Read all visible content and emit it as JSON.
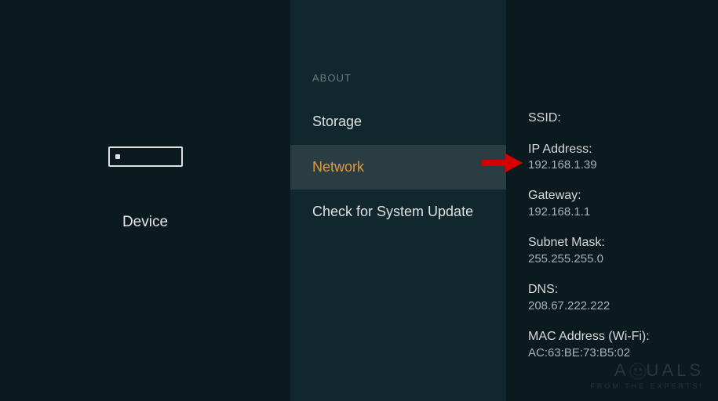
{
  "left": {
    "label": "Device"
  },
  "middle": {
    "header": "ABOUT",
    "items": [
      {
        "label": "Storage",
        "selected": false
      },
      {
        "label": "Network",
        "selected": true
      },
      {
        "label": "Check for System Update",
        "selected": false
      }
    ]
  },
  "details": {
    "ssid": {
      "label": "SSID:",
      "value": ""
    },
    "ip": {
      "label": "IP Address:",
      "value": "192.168.1.39"
    },
    "gateway": {
      "label": "Gateway:",
      "value": "192.168.1.1"
    },
    "subnet": {
      "label": "Subnet Mask:",
      "value": "255.255.255.0"
    },
    "dns": {
      "label": "DNS:",
      "value": "208.67.222.222"
    },
    "mac": {
      "label": "MAC Address (Wi-Fi):",
      "value": "AC:63:BE:73:B5:02"
    }
  },
  "watermark": {
    "main": "A    UALS",
    "sub": "FROM THE EXPERTS!"
  }
}
